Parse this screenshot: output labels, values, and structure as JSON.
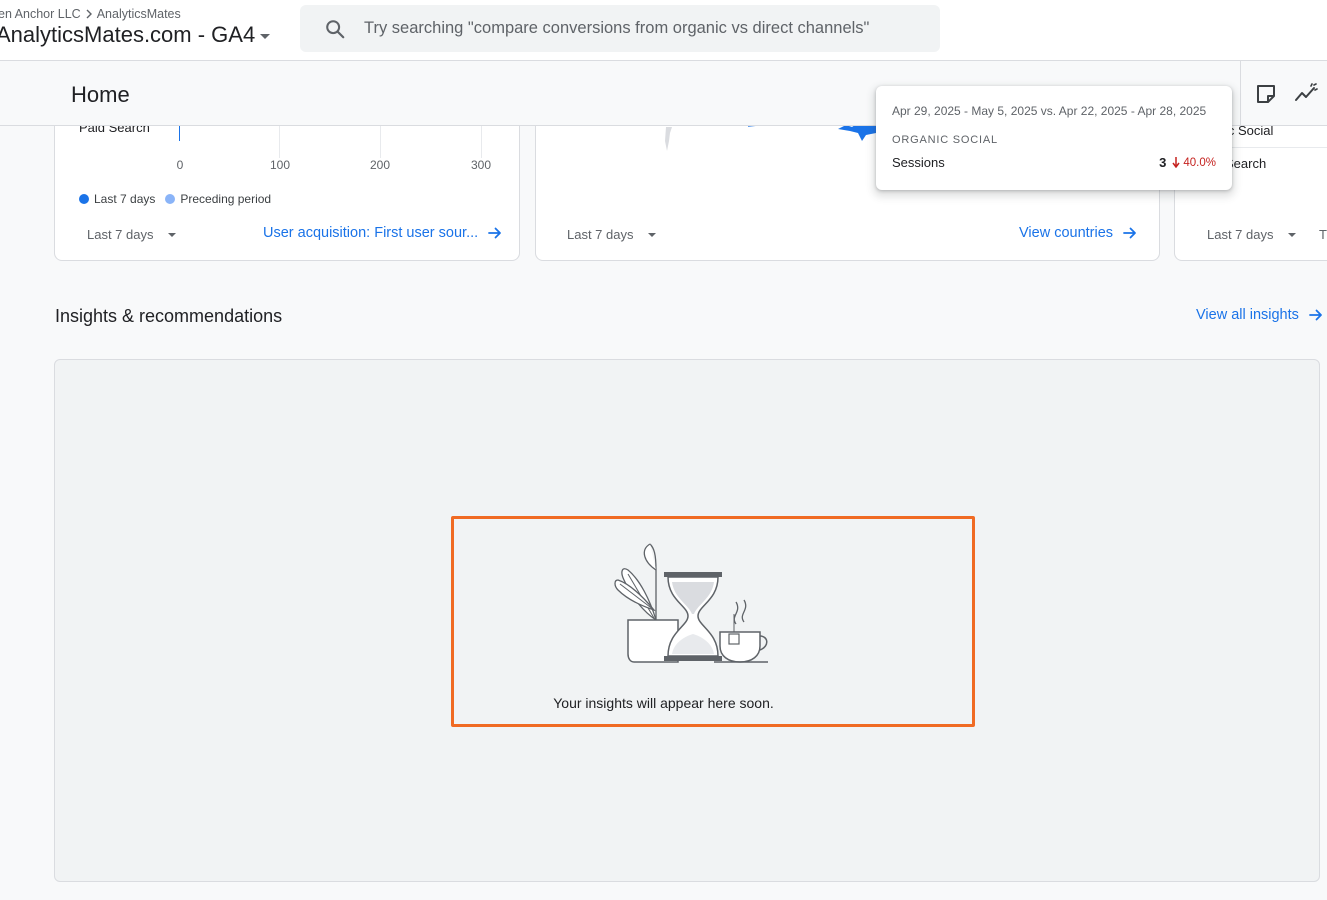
{
  "topbar": {
    "breadcrumb": [
      "en Anchor LLC",
      "AnalyticsMates"
    ],
    "property_name": "AnalyticsMates.com - GA4",
    "search_placeholder": "Try searching \"compare conversions from organic vs direct channels\""
  },
  "header": {
    "title": "Home"
  },
  "cards": [
    {
      "row_label": "Paid Search",
      "ticks": [
        "0",
        "100",
        "200",
        "300"
      ],
      "legend": [
        {
          "label": "Last 7 days",
          "color": "#1a73e8"
        },
        {
          "label": "Preceding period",
          "color": "#8ab4f8"
        }
      ],
      "date_range": "Last 7 days",
      "link_label": "User acquisition: First user sour..."
    },
    {
      "date_range": "Last 7 days",
      "link_label": "View countries"
    },
    {
      "row_labels": [
        "ic Social",
        "Search"
      ],
      "date_range": "Last 7 days",
      "link_cut": "T"
    }
  ],
  "tooltip": {
    "date_range": "Apr 29, 2025 - May 5, 2025 vs. Apr 22, 2025 - Apr 28, 2025",
    "channel": "ORGANIC SOCIAL",
    "metric": "Sessions",
    "value": "3",
    "change": "40.0%",
    "change_color": "#c5221f"
  },
  "insights": {
    "title": "Insights & recommendations",
    "view_all_label": "View all insights",
    "empty_message": "Your insights will appear here soon.",
    "highlight_color": "#f06a23"
  },
  "colors": {
    "accent": "#1a73e8",
    "text": "#202124",
    "muted": "#5f6368"
  }
}
